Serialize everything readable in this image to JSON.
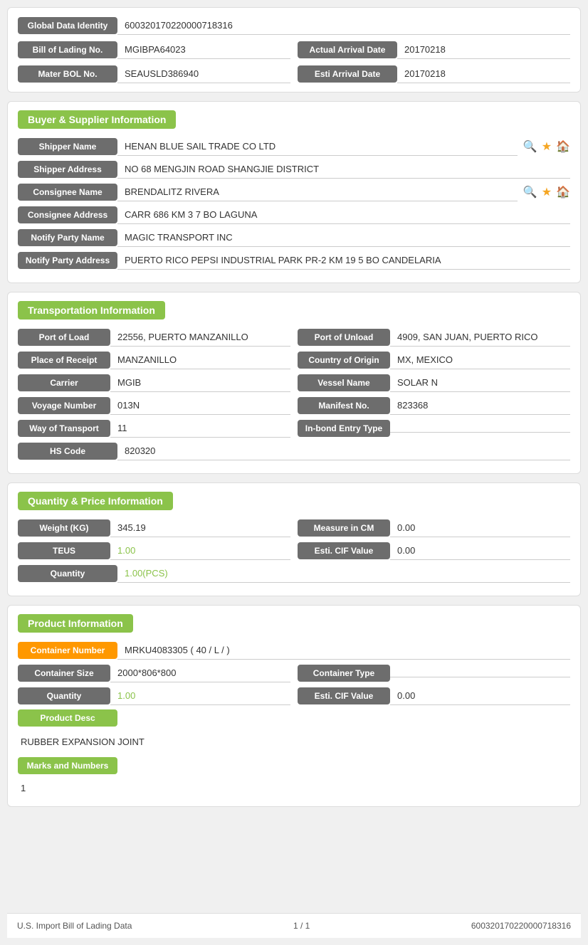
{
  "global": {
    "data_identity_label": "Global Data Identity",
    "data_identity_value": "600320170220000718316",
    "bol_label": "Bill of Lading No.",
    "bol_value": "MGIBPA64023",
    "actual_arrival_label": "Actual Arrival Date",
    "actual_arrival_value": "20170218",
    "master_bol_label": "Mater BOL No.",
    "master_bol_value": "SEAUSLD386940",
    "esti_arrival_label": "Esti Arrival Date",
    "esti_arrival_value": "20170218"
  },
  "buyer_supplier": {
    "section_title": "Buyer & Supplier Information",
    "shipper_name_label": "Shipper Name",
    "shipper_name_value": "HENAN BLUE SAIL TRADE CO LTD",
    "shipper_address_label": "Shipper Address",
    "shipper_address_value": "NO 68 MENGJIN ROAD SHANGJIE DISTRICT",
    "consignee_name_label": "Consignee Name",
    "consignee_name_value": "BRENDALITZ RIVERA",
    "consignee_address_label": "Consignee Address",
    "consignee_address_value": "CARR 686 KM 3 7 BO LAGUNA",
    "notify_party_name_label": "Notify Party Name",
    "notify_party_name_value": "MAGIC TRANSPORT INC",
    "notify_party_address_label": "Notify Party Address",
    "notify_party_address_value": "PUERTO RICO PEPSI INDUSTRIAL PARK PR-2 KM 19 5 BO CANDELARIA"
  },
  "transportation": {
    "section_title": "Transportation Information",
    "port_of_load_label": "Port of Load",
    "port_of_load_value": "22556, PUERTO MANZANILLO",
    "port_of_unload_label": "Port of Unload",
    "port_of_unload_value": "4909, SAN JUAN, PUERTO RICO",
    "place_of_receipt_label": "Place of Receipt",
    "place_of_receipt_value": "MANZANILLO",
    "country_of_origin_label": "Country of Origin",
    "country_of_origin_value": "MX, MEXICO",
    "carrier_label": "Carrier",
    "carrier_value": "MGIB",
    "vessel_name_label": "Vessel Name",
    "vessel_name_value": "SOLAR N",
    "voyage_number_label": "Voyage Number",
    "voyage_number_value": "013N",
    "manifest_no_label": "Manifest No.",
    "manifest_no_value": "823368",
    "way_of_transport_label": "Way of Transport",
    "way_of_transport_value": "11",
    "inbond_entry_label": "In-bond Entry Type",
    "inbond_entry_value": "",
    "hs_code_label": "HS Code",
    "hs_code_value": "820320"
  },
  "quantity_price": {
    "section_title": "Quantity & Price Information",
    "weight_label": "Weight (KG)",
    "weight_value": "345.19",
    "measure_label": "Measure in CM",
    "measure_value": "0.00",
    "teus_label": "TEUS",
    "teus_value": "1.00",
    "esti_cif_label": "Esti. CIF Value",
    "esti_cif_value": "0.00",
    "quantity_label": "Quantity",
    "quantity_value": "1.00(PCS)"
  },
  "product": {
    "section_title": "Product Information",
    "container_number_label": "Container Number",
    "container_number_value": "MRKU4083305 ( 40 / L / )",
    "container_size_label": "Container Size",
    "container_size_value": "2000*806*800",
    "container_type_label": "Container Type",
    "container_type_value": "",
    "quantity_label": "Quantity",
    "quantity_value": "1.00",
    "esti_cif_label": "Esti. CIF Value",
    "esti_cif_value": "0.00",
    "product_desc_label": "Product Desc",
    "product_desc_value": "RUBBER EXPANSION JOINT",
    "marks_label": "Marks and Numbers",
    "marks_value": "1"
  },
  "footer": {
    "left_text": "U.S. Import Bill of Lading Data",
    "center_text": "1 / 1",
    "right_text": "600320170220000718316"
  },
  "icons": {
    "search": "🔍",
    "star": "★",
    "home": "🏠"
  }
}
